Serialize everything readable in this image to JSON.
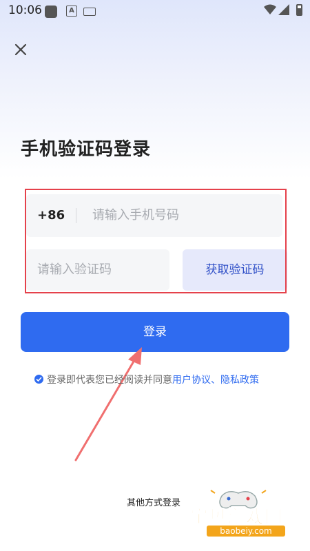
{
  "status_bar": {
    "time": "10:06",
    "icons": [
      "app-square-icon",
      "a-icon",
      "keyboard-icon",
      "wifi-icon",
      "signal-icon",
      "battery-icon"
    ]
  },
  "header": {
    "close_icon": "close-icon"
  },
  "page": {
    "title": "手机验证码登录"
  },
  "form": {
    "country_code": "+86",
    "phone_placeholder": "请输入手机号码",
    "code_placeholder": "请输入验证码",
    "get_code_label": "获取验证码"
  },
  "login": {
    "label": "登录"
  },
  "agreement": {
    "prefix": "登录即代表您已经阅读并同意",
    "links": "用户协议、隐私政策",
    "checked": true
  },
  "footer": {
    "other_methods": "其他方式登录"
  },
  "watermark": {
    "text": "宝贝游戏网",
    "url": "baobeiy.com"
  },
  "colors": {
    "accent": "#2f6bf0",
    "highlight_border": "#e5414b",
    "arrow": "#f06f6f",
    "watermark": "#f3a51b"
  }
}
